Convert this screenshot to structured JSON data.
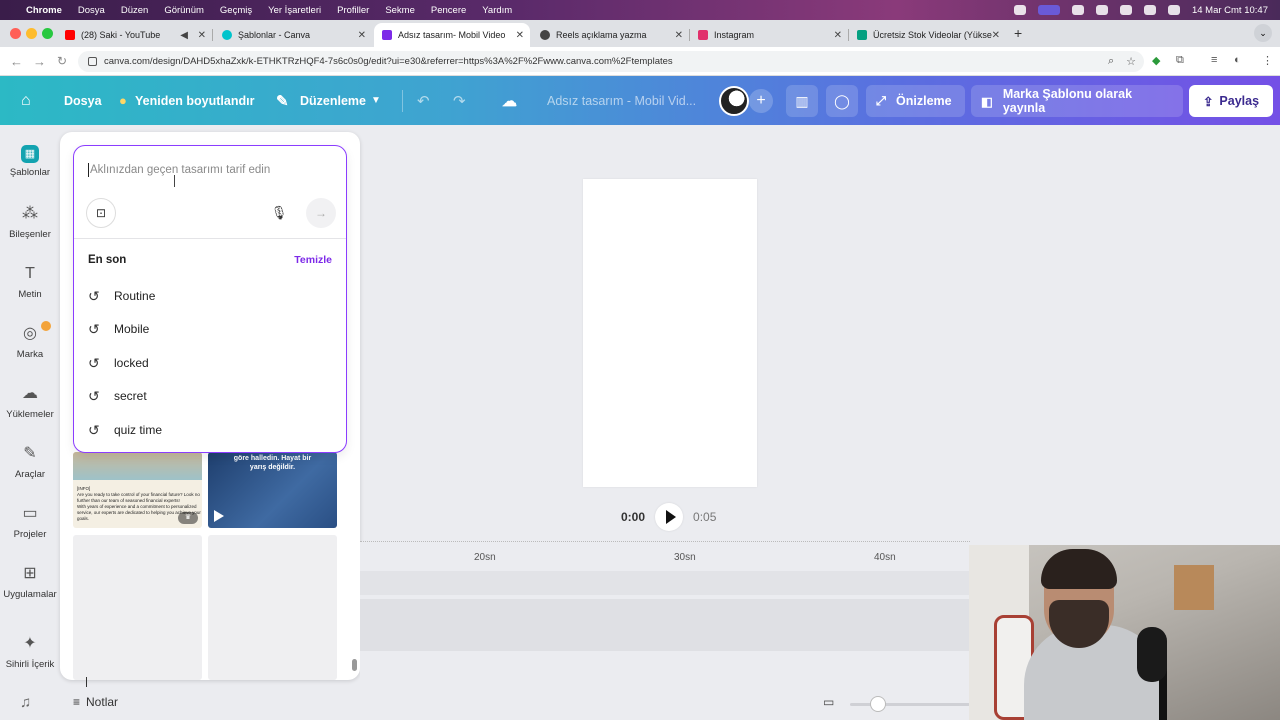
{
  "menubar": {
    "items": [
      "Chrome",
      "Dosya",
      "Düzen",
      "Görünüm",
      "Geçmiş",
      "Yer İşaretleri",
      "Profiller",
      "Sekme",
      "Pencere",
      "Yardım"
    ],
    "clock": "14 Mar Cmt  10:47"
  },
  "tabs": [
    {
      "title": "(28) Saki - YouTube",
      "favicon_color": "#ff0000"
    },
    {
      "title": "Şablonlar - Canva",
      "favicon_color": "#00c4cc"
    },
    {
      "title": "Adsız tasarım- Mobil Video",
      "favicon_color": "#7d2ae8"
    },
    {
      "title": "Reels açıklama yazma",
      "favicon_color": "#444444"
    },
    {
      "title": "Instagram",
      "favicon_color": "#e1306c"
    },
    {
      "title": "Ücretsiz Stok Videolar (Yükse",
      "favicon_color": "#05a081"
    }
  ],
  "address": {
    "url": "canva.com/design/DAHD5xhaZxk/k-ETHKTRzHQF4-7s6c0s0g/edit?ui=e30&referrer=https%3A%2F%2Fwww.canva.com%2Ftemplates"
  },
  "header": {
    "file": "Dosya",
    "resize": "Yeniden boyutlandır",
    "edit": "Düzenleme",
    "design_title": "Adsız tasarım - Mobil Vid...",
    "preview": "Önizleme",
    "publish_template": "Marka Şablonu olarak yayınla",
    "share": "Paylaş"
  },
  "sidebar": {
    "items": [
      {
        "label": "Şablonlar",
        "icon": "templates-icon"
      },
      {
        "label": "Bileşenler",
        "icon": "elements-icon"
      },
      {
        "label": "Metin",
        "icon": "text-icon"
      },
      {
        "label": "Marka",
        "icon": "brand-icon"
      },
      {
        "label": "Yüklemeler",
        "icon": "uploads-icon"
      },
      {
        "label": "Araçlar",
        "icon": "draw-icon"
      },
      {
        "label": "Projeler",
        "icon": "folder-icon"
      },
      {
        "label": "Uygulamalar",
        "icon": "apps-icon"
      },
      {
        "label": "Sihirli İçerik",
        "icon": "magic-icon"
      }
    ]
  },
  "search": {
    "placeholder": "Aklınızdan geçen tasarımı tarif edin",
    "recent_title": "En son",
    "clear_label": "Temizle",
    "recent": [
      "Routine",
      "Mobile",
      "locked",
      "secret",
      "quiz time"
    ]
  },
  "templates": {
    "thumb_b_text": "göre halledin. Hayat bir\nyarış değildir.",
    "thumb_a_text": "[INFO]\nAre you ready to take control of your financial future? Look no\nfurther than our team of seasoned financial experts!\nWith years of experience and a commitment to personalized\nservice, our experts are dedicated to helping you achieve your\ngoals."
  },
  "playback": {
    "current": "0:00",
    "duration": "0:05"
  },
  "timeline": {
    "marks": [
      "20sn",
      "30sn",
      "40sn"
    ]
  },
  "footer": {
    "notes": "Notlar"
  }
}
